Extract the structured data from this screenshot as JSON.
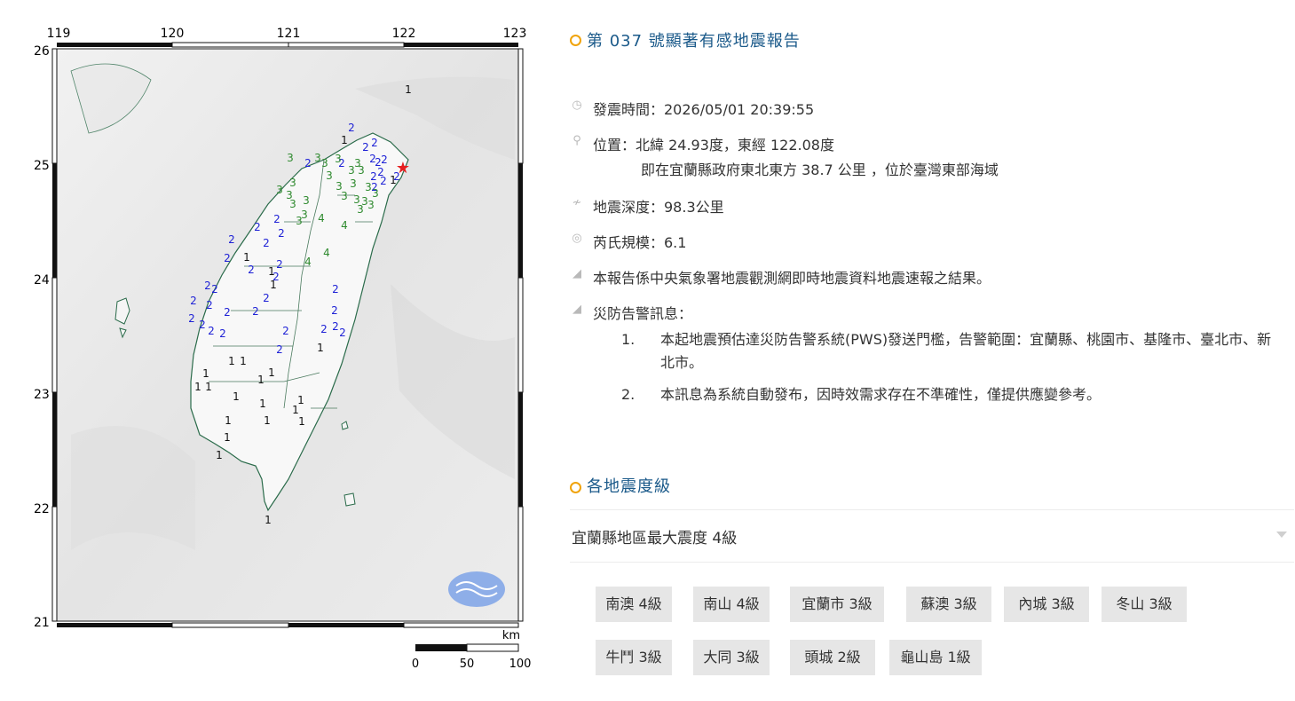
{
  "report": {
    "title": "第 037 號顯著有感地震報告",
    "time_label": "發震時間：2026/05/01 20:39:55",
    "location_label": "位置：北緯 24.93度，東經 122.08度",
    "location_desc": "即在宜蘭縣政府東北東方 38.7 公里 ，位於臺灣東部海域",
    "depth_label": "地震深度：98.3公里",
    "magnitude_label": "芮氏規模：6.1",
    "source_note": "本報告係中央氣象署地震觀測網即時地震資料地震速報之結果。",
    "warning_title": "災防告警訊息：",
    "warnings": [
      {
        "num": "1.",
        "text": "本起地震預估達災防告警系統(PWS)發送門檻，告警範圍：宜蘭縣、桃園市、基隆市、臺北市、新北市。"
      },
      {
        "num": "2.",
        "text": "本訊息為系統自動發布，因時效需求存在不準確性，僅提供應變參考。"
      }
    ]
  },
  "intensity_section": {
    "title": "各地震度級",
    "region_header": "宜蘭縣地區最大震度 4級",
    "stations": [
      "南澳 4級",
      "南山 4級",
      "宜蘭市 3級",
      "蘇澳 3級",
      "內城 3級",
      "冬山 3級",
      "牛鬥 3級",
      "大同 3級",
      "頭城 2級",
      "龜山島 1級"
    ]
  },
  "map": {
    "lon_labels": [
      "119",
      "120",
      "121",
      "122",
      "123"
    ],
    "lat_labels": [
      "26",
      "25",
      "24",
      "23",
      "22",
      "21"
    ],
    "scale_unit": "km",
    "scale_ticks": [
      "0",
      "50",
      "100"
    ],
    "intensity_colors": {
      "1": "#111111",
      "2": "#1f22d6",
      "3": "#2f8a2f",
      "4": "#2f8a2f"
    },
    "epicenter_color": "#e52020",
    "markers_1": [
      "1",
      "1",
      "1",
      "1",
      "1",
      "1",
      "1",
      "1",
      "1",
      "1",
      "1",
      "1",
      "1",
      "1",
      "1",
      "1",
      "1",
      "1",
      "1",
      "1",
      "1",
      "1",
      "1",
      "1"
    ],
    "markers_2": [
      "2",
      "2",
      "2",
      "2",
      "2",
      "2",
      "2",
      "2",
      "2",
      "2",
      "2",
      "2",
      "2",
      "2",
      "2",
      "2",
      "2",
      "2",
      "2",
      "2",
      "2",
      "2",
      "2",
      "2",
      "2",
      "2",
      "2",
      "2",
      "2",
      "2",
      "2",
      "2",
      "2",
      "2",
      "2",
      "2",
      "2",
      "2",
      "2",
      "2"
    ],
    "markers_3": [
      "3",
      "3",
      "3",
      "3",
      "3",
      "3",
      "3",
      "3",
      "3",
      "3",
      "3",
      "3",
      "3",
      "3",
      "3",
      "3",
      "3",
      "3",
      "3",
      "3",
      "3",
      "3",
      "3",
      "3"
    ],
    "markers_4": [
      "4",
      "4",
      "4",
      "4"
    ]
  }
}
